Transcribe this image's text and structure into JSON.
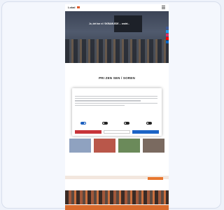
{
  "header": {
    "logo_text": "Lokal",
    "logo_color": "#e05a2a"
  },
  "hero": {
    "headline": "Jo, det har vi / SKRAMLEDE ... andet...",
    "caption": ""
  },
  "social_colors": [
    "#3b5998",
    "#1da1f2",
    "#e1306c",
    "#ff0000",
    "#0a66c2"
  ],
  "section": {
    "label": "",
    "title": "PRI ZEN SEN / SOREN"
  },
  "consent": {
    "brand": "",
    "title": "",
    "options": [
      {
        "label": "",
        "on": true
      },
      {
        "label": "",
        "on": false
      },
      {
        "label": "",
        "on": false
      },
      {
        "label": "",
        "on": false
      }
    ],
    "details_link": "",
    "deny_label": "",
    "select_label": "",
    "allow_label": ""
  },
  "news": [
    {
      "title": "",
      "thumb_color": "#8fa2c0"
    },
    {
      "title": "",
      "thumb_color": "#b9574a"
    },
    {
      "title": "",
      "thumb_color": "#6b8a5a"
    },
    {
      "title": "",
      "thumb_color": "#7a6a60"
    }
  ],
  "footer": {
    "text": ""
  }
}
